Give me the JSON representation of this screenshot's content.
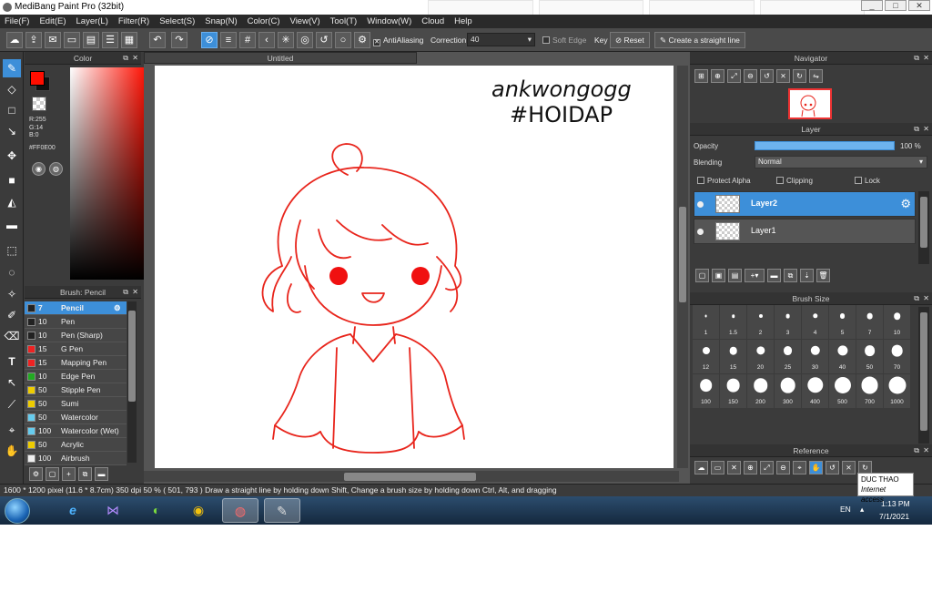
{
  "window": {
    "title": "MediBang Paint Pro (32bit)",
    "buttons": [
      "_",
      "□",
      "✕"
    ]
  },
  "background_tabs": [
    "",
    "",
    "",
    ""
  ],
  "menu": [
    "File(F)",
    "Edit(E)",
    "Layer(L)",
    "Filter(R)",
    "Select(S)",
    "Snap(N)",
    "Color(C)",
    "View(V)",
    "Tool(T)",
    "Window(W)",
    "Cloud",
    "Help"
  ],
  "toolbar": {
    "antialiasing_label": "AntiAliasing",
    "correction_label": "Correction",
    "correction_value": "40",
    "soft_edge_label": "Soft Edge",
    "key_label": "Key",
    "reset_label": "Reset",
    "straight_line_label": "Create a straight line"
  },
  "color_panel": {
    "title": "Color",
    "r": "R:255",
    "g": "G:14",
    "b": "B:0",
    "hex": "#FF0E00",
    "fg_color": "#ff0e00"
  },
  "brush_panel": {
    "title": "Brush: Pencil",
    "items": [
      {
        "size": "7",
        "name": "Pencil",
        "color": "#222222"
      },
      {
        "size": "10",
        "name": "Pen",
        "color": "#222222"
      },
      {
        "size": "10",
        "name": "Pen (Sharp)",
        "color": "#222222"
      },
      {
        "size": "15",
        "name": "G Pen",
        "color": "#ee2222"
      },
      {
        "size": "15",
        "name": "Mapping Pen",
        "color": "#ee2222"
      },
      {
        "size": "10",
        "name": "Edge Pen",
        "color": "#22aa22"
      },
      {
        "size": "50",
        "name": "Stipple Pen",
        "color": "#eecc00"
      },
      {
        "size": "50",
        "name": "Sumi",
        "color": "#eecc00"
      },
      {
        "size": "50",
        "name": "Watercolor",
        "color": "#66ccee"
      },
      {
        "size": "100",
        "name": "Watercolor (Wet)",
        "color": "#66ccee"
      },
      {
        "size": "50",
        "name": "Acrylic",
        "color": "#eecc00"
      },
      {
        "size": "100",
        "name": "Airbrush",
        "color": "#eeeeee"
      }
    ]
  },
  "document": {
    "tab_title": "Untitled",
    "handwriting_line1": "ankwongogg",
    "handwriting_line2": "#HOIDAP"
  },
  "navigator": {
    "title": "Navigator"
  },
  "layer_panel": {
    "title": "Layer",
    "opacity_label": "Opacity",
    "opacity_value": "100 %",
    "opacity": 1.0,
    "blending_label": "Blending",
    "blending_value": "Normal",
    "protect_alpha": "Protect Alpha",
    "clipping": "Clipping",
    "lock": "Lock",
    "layers": [
      {
        "name": "Layer2"
      },
      {
        "name": "Layer1"
      }
    ]
  },
  "brush_size_panel": {
    "title": "Brush Size",
    "sizes": [
      "1",
      "1.5",
      "2",
      "3",
      "4",
      "5",
      "7",
      "10",
      "12",
      "15",
      "20",
      "25",
      "30",
      "40",
      "50",
      "70",
      "100",
      "150",
      "200",
      "300",
      "400",
      "500",
      "700",
      "1000"
    ]
  },
  "reference": {
    "title": "Reference"
  },
  "status_bar": {
    "dimensions": "1600 * 1200 pixel",
    "physical": "(11.6 * 8.7cm)",
    "dpi": "350 dpi",
    "zoom": "50 %",
    "coords": "( 501, 793 )",
    "hint": "Draw a straight line by holding down Shift, Change a brush size by holding down Ctrl, Alt, and dragging"
  },
  "taskbar": {
    "tooltip_title": "DUC THAO",
    "tooltip_sub": "Internet access",
    "lang": "EN",
    "time": "1:13 PM",
    "date": "7/1/2021"
  },
  "accent": "#3d8fd9",
  "stroke_color": "#e8251c"
}
